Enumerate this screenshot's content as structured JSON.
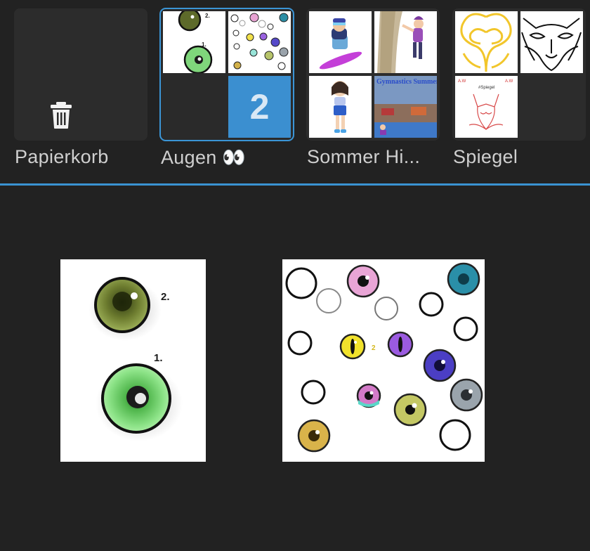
{
  "folders": [
    {
      "label": "Papierkorb",
      "icon": "trash-icon"
    },
    {
      "label": "Augen 👀",
      "count": "2",
      "selected": true
    },
    {
      "label": "Sommer Hi...",
      "thumb_text": "Gymnastics Summer"
    },
    {
      "label": "Spiegel",
      "thumb_text": "#Spiegel"
    }
  ],
  "colors": {
    "accent": "#3b95d6",
    "background": "#222222",
    "label": "#cfcfcf"
  },
  "artwork": {
    "eyes1_labels": [
      "2.",
      "1."
    ],
    "eyes2_label": "2"
  }
}
